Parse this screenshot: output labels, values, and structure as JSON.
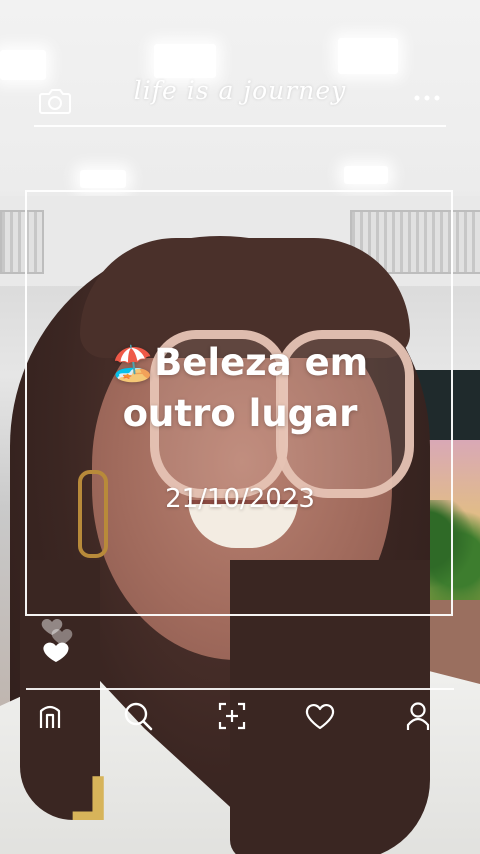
{
  "header": {
    "title": "life is a journey",
    "left_icon": "camera-icon",
    "right_icon": "more-icon"
  },
  "card": {
    "emoji": "🏖️",
    "headline_line1": "Beleza em",
    "headline_line2": "outro lugar",
    "date": "21/10/2023"
  },
  "reactions": {
    "icons": [
      "heart-icon",
      "heart-icon",
      "heart-icon"
    ]
  },
  "bottom_nav": {
    "items": [
      {
        "name": "home-icon"
      },
      {
        "name": "search-icon"
      },
      {
        "name": "add-icon"
      },
      {
        "name": "heart-icon"
      },
      {
        "name": "profile-icon"
      }
    ]
  },
  "colors": {
    "overlay": "#ffffff"
  }
}
